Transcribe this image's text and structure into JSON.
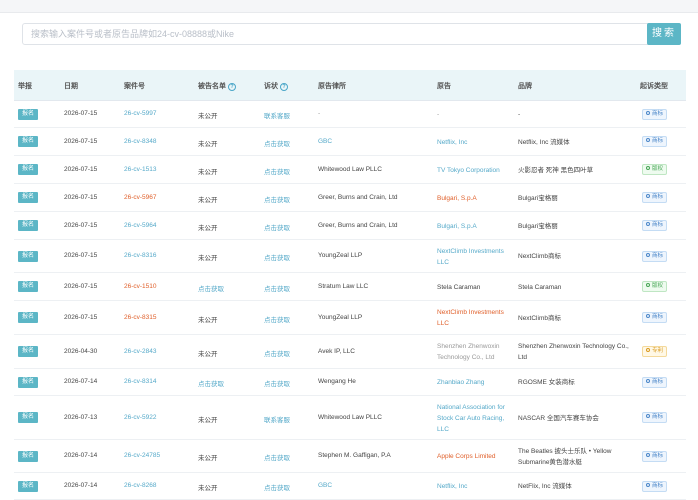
{
  "search": {
    "placeholder": "搜索输入案件号或者原告品牌如24-cv-08888或Nike",
    "button_label": "搜索"
  },
  "table": {
    "headers": {
      "action": "举报",
      "date": "日期",
      "case_no": "案件号",
      "defendant_list": "被告名单",
      "complaint": "诉状",
      "law_firm": "原告律所",
      "plaintiff": "原告",
      "brand": "品牌",
      "type": "起诉类型"
    },
    "rows": [
      {
        "action": "报名",
        "date": "2026-07-15",
        "case_no": "26-cv-5997",
        "case_style": "link",
        "defendant": "未公开",
        "defendant_style": "plain",
        "complaint": "联系客服",
        "complaint_style": "link",
        "law_firm": "-",
        "law_firm_style": "muted",
        "plaintiff": "-",
        "plaintiff_style": "muted",
        "brand": "-",
        "type": "商标",
        "type_style": "tm",
        "h": 26
      },
      {
        "action": "报名",
        "date": "2026-07-15",
        "case_no": "26-cv-8348",
        "case_style": "link",
        "defendant": "未公开",
        "defendant_style": "plain",
        "complaint": "点击获取",
        "complaint_style": "link",
        "law_firm": "GBC",
        "law_firm_style": "link",
        "plaintiff": "Netflix, Inc",
        "plaintiff_style": "link",
        "brand": "Netflix, Inc 流媒体",
        "type": "商标",
        "type_style": "tm",
        "h": 27
      },
      {
        "action": "报名",
        "date": "2026-07-15",
        "case_no": "26-cv-1513",
        "case_style": "link",
        "defendant": "未公开",
        "defendant_style": "plain",
        "complaint": "点击获取",
        "complaint_style": "link",
        "law_firm": "Whitewood Law PLLC",
        "law_firm_style": "plain",
        "plaintiff": "TV Tokyo Corporation",
        "plaintiff_style": "link",
        "brand": "火影忍者 死神 黑色四叶草",
        "type": "版权",
        "type_style": "cr",
        "h": 27
      },
      {
        "action": "报名",
        "date": "2026-07-15",
        "case_no": "26-cv-5967",
        "case_style": "red",
        "defendant": "未公开",
        "defendant_style": "plain",
        "complaint": "点击获取",
        "complaint_style": "link",
        "law_firm": "Greer, Burns and Crain, Ltd",
        "law_firm_style": "plain",
        "plaintiff": "Bulgari, S.p.A",
        "plaintiff_style": "red",
        "brand": "Bulgari宝格丽",
        "type": "商标",
        "type_style": "tm",
        "h": 27
      },
      {
        "action": "报名",
        "date": "2026-07-15",
        "case_no": "26-cv-5964",
        "case_style": "link",
        "defendant": "未公开",
        "defendant_style": "plain",
        "complaint": "点击获取",
        "complaint_style": "link",
        "law_firm": "Greer, Burns and Crain, Ltd",
        "law_firm_style": "plain",
        "plaintiff": "Bulgari, S.p.A",
        "plaintiff_style": "link",
        "brand": "Bulgari宝格丽",
        "type": "商标",
        "type_style": "tm",
        "h": 27
      },
      {
        "action": "报名",
        "date": "2026-07-15",
        "case_no": "26-cv-8316",
        "case_style": "link",
        "defendant": "未公开",
        "defendant_style": "plain",
        "complaint": "点击获取",
        "complaint_style": "link",
        "law_firm": "YoungZeal LLP",
        "law_firm_style": "plain",
        "plaintiff": "NextClimb Investments LLC",
        "plaintiff_style": "link",
        "brand": "NextClimb商标",
        "type": "商标",
        "type_style": "tm",
        "h": 32
      },
      {
        "action": "报名",
        "date": "2026-07-15",
        "case_no": "26-cv-1510",
        "case_style": "red",
        "defendant": "点击获取",
        "defendant_style": "link",
        "complaint": "点击获取",
        "complaint_style": "link",
        "law_firm": "Stratum Law LLC",
        "law_firm_style": "plain",
        "plaintiff": "Stela Caraman",
        "plaintiff_style": "plain",
        "brand": "Stela Caraman",
        "type": "版权",
        "type_style": "cr",
        "h": 27
      },
      {
        "action": "报名",
        "date": "2026-07-15",
        "case_no": "26-cv-8315",
        "case_style": "red",
        "defendant": "未公开",
        "defendant_style": "plain",
        "complaint": "点击获取",
        "complaint_style": "link",
        "law_firm": "YoungZeal LLP",
        "law_firm_style": "plain",
        "plaintiff": "NextClimb Investments LLC",
        "plaintiff_style": "red",
        "brand": "NextClimb商标",
        "type": "商标",
        "type_style": "tm",
        "h": 33
      },
      {
        "action": "报名",
        "date": "2026-04-30",
        "case_no": "26-cv-2843",
        "case_style": "link",
        "defendant": "未公开",
        "defendant_style": "plain",
        "complaint": "点击获取",
        "complaint_style": "link",
        "law_firm": "Avek IP, LLC",
        "law_firm_style": "plain",
        "plaintiff": "Shenzhen Zhenwoxin Technology Co., Ltd",
        "plaintiff_style": "muted",
        "brand": "Shenzhen Zhenwoxin Technology Co., Ltd",
        "type": "专利",
        "type_style": "pt",
        "h": 33
      },
      {
        "action": "报名",
        "date": "2026-07-14",
        "case_no": "26-cv-8314",
        "case_style": "link",
        "defendant": "点击获取",
        "defendant_style": "link",
        "complaint": "点击获取",
        "complaint_style": "link",
        "law_firm": "Wengang He",
        "law_firm_style": "plain",
        "plaintiff": "Zhanbiao Zhang",
        "plaintiff_style": "link",
        "brand": "RGOSME 女装商标",
        "type": "商标",
        "type_style": "tm",
        "h": 26
      },
      {
        "action": "报名",
        "date": "2026-07-13",
        "case_no": "26-cv-5922",
        "case_style": "link",
        "defendant": "未公开",
        "defendant_style": "plain",
        "complaint": "联系客服",
        "complaint_style": "link",
        "law_firm": "Whitewood Law PLLC",
        "law_firm_style": "plain",
        "plaintiff": "National Association for Stock Car Auto Racing, LLC",
        "plaintiff_style": "link",
        "brand": "NASCAR 全国汽车赛车协会",
        "type": "商标",
        "type_style": "tm",
        "h": 43
      },
      {
        "action": "报名",
        "date": "2026-07-14",
        "case_no": "26-cv-24785",
        "case_style": "link",
        "defendant": "未公开",
        "defendant_style": "plain",
        "complaint": "点击获取",
        "complaint_style": "link",
        "law_firm": "Stephen M. Gaffigan, P.A",
        "law_firm_style": "plain",
        "plaintiff": "Apple Corps Limited",
        "plaintiff_style": "red",
        "brand": "The Beatles 披头士乐队 • Yellow Submarine黄色潜水艇",
        "type": "商标",
        "type_style": "tm",
        "h": 32
      },
      {
        "action": "报名",
        "date": "2026-07-14",
        "case_no": "26-cv-8268",
        "case_style": "link",
        "defendant": "未公开",
        "defendant_style": "plain",
        "complaint": "点击获取",
        "complaint_style": "link",
        "law_firm": "GBC",
        "law_firm_style": "link",
        "plaintiff": "Netflix, Inc",
        "plaintiff_style": "link",
        "brand": "NetFlix, Inc 流媒体",
        "type": "商标",
        "type_style": "tm",
        "h": 26
      }
    ]
  }
}
